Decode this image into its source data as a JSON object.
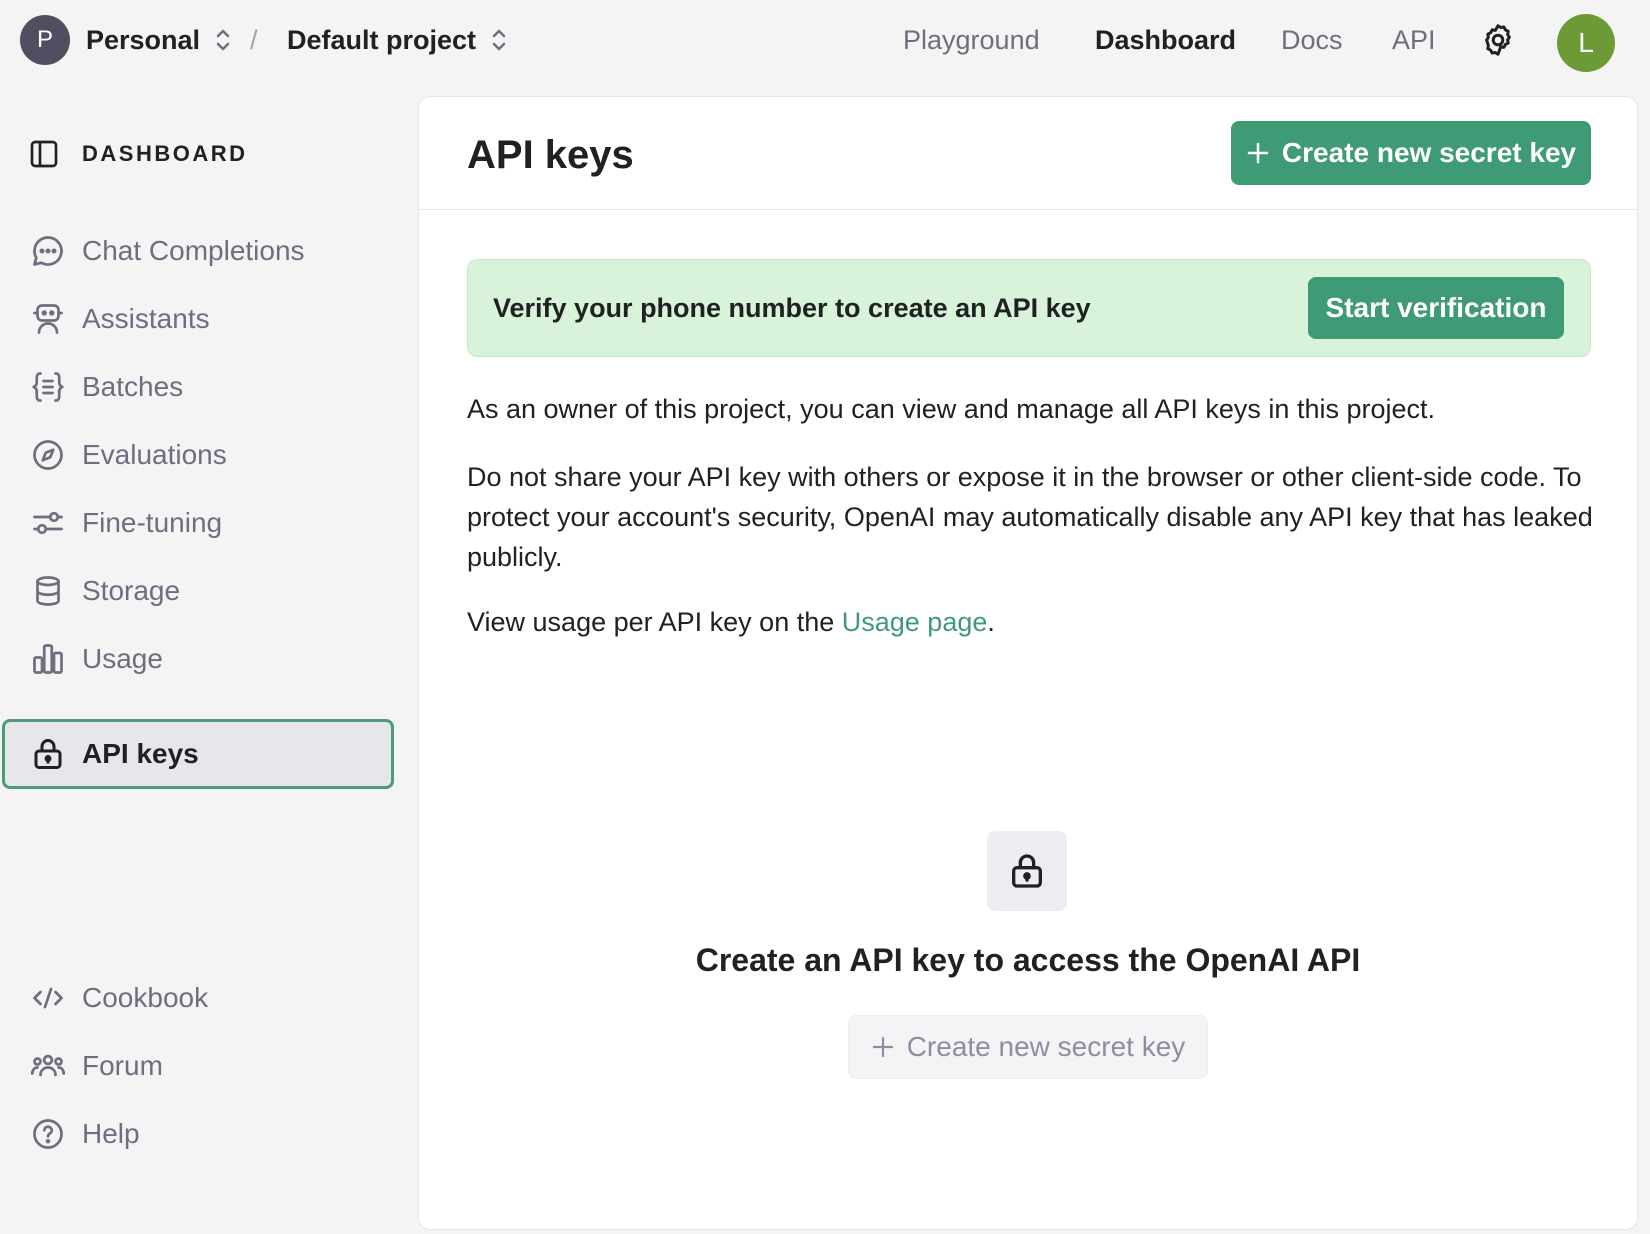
{
  "topbar": {
    "org_initial": "P",
    "org_name": "Personal",
    "separator": "/",
    "project_name": "Default project",
    "nav": [
      {
        "label": "Playground",
        "active": false
      },
      {
        "label": "Dashboard",
        "active": true
      },
      {
        "label": "Docs",
        "active": false
      },
      {
        "label": "API",
        "active": false
      }
    ],
    "settings_icon": "gear-icon",
    "user_initial": "L",
    "user_avatar_color": "#6c9a36"
  },
  "sidebar": {
    "heading": "DASHBOARD",
    "heading_icon": "sidebar-toggle-icon",
    "items": [
      {
        "label": "Chat Completions",
        "icon": "chat-icon"
      },
      {
        "label": "Assistants",
        "icon": "robot-icon"
      },
      {
        "label": "Batches",
        "icon": "braces-list-icon"
      },
      {
        "label": "Evaluations",
        "icon": "compass-icon"
      },
      {
        "label": "Fine-tuning",
        "icon": "sliders-icon"
      },
      {
        "label": "Storage",
        "icon": "database-icon"
      },
      {
        "label": "Usage",
        "icon": "bar-chart-icon"
      },
      {
        "label": "API keys",
        "icon": "lock-icon",
        "active": true
      }
    ],
    "footer_items": [
      {
        "label": "Cookbook",
        "icon": "code-icon"
      },
      {
        "label": "Forum",
        "icon": "people-icon"
      },
      {
        "label": "Help",
        "icon": "help-icon"
      }
    ]
  },
  "main": {
    "title": "API keys",
    "create_button": "Create new secret key",
    "verify_banner": {
      "text": "Verify your phone number to create an API key",
      "button": "Start verification"
    },
    "para1": "As an owner of this project, you can view and manage all API keys in this project.",
    "para2": "Do not share your API key with others or expose it in the browser or other client-side code. To protect your account's security, OpenAI may automatically disable any API key that has leaked publicly.",
    "para3_prefix": "View usage per API key on the ",
    "para3_link": "Usage page",
    "para3_suffix": ".",
    "empty_state": {
      "icon": "lock-icon",
      "title": "Create an API key to access the OpenAI API",
      "button": "Create new secret key"
    }
  },
  "colors": {
    "accent_green": "#3f9a76",
    "banner_bg": "#d9f3da",
    "active_border": "#4e9a7b"
  }
}
